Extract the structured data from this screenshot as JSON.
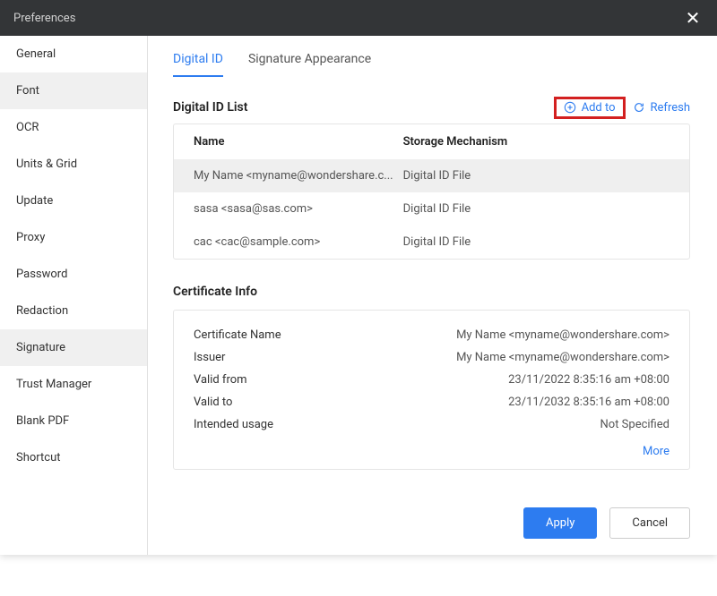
{
  "window": {
    "title": "Preferences"
  },
  "sidebar": {
    "items": [
      {
        "label": "General"
      },
      {
        "label": "Font"
      },
      {
        "label": "OCR"
      },
      {
        "label": "Units & Grid"
      },
      {
        "label": "Update"
      },
      {
        "label": "Proxy"
      },
      {
        "label": "Password"
      },
      {
        "label": "Redaction"
      },
      {
        "label": "Signature"
      },
      {
        "label": "Trust Manager"
      },
      {
        "label": "Blank PDF"
      },
      {
        "label": "Shortcut"
      }
    ],
    "selected_index": 8,
    "hover_index": 1
  },
  "tabs": [
    {
      "label": "Digital ID",
      "active": true
    },
    {
      "label": "Signature Appearance",
      "active": false
    }
  ],
  "list": {
    "title": "Digital ID List",
    "add_label": "Add to",
    "refresh_label": "Refresh",
    "columns": {
      "name": "Name",
      "storage": "Storage Mechanism"
    },
    "rows": [
      {
        "name": "My Name <myname@wondershare.c...",
        "storage": "Digital ID File",
        "selected": true
      },
      {
        "name": "sasa <sasa@sas.com>",
        "storage": "Digital ID File",
        "selected": false
      },
      {
        "name": "cac <cac@sample.com>",
        "storage": "Digital ID File",
        "selected": false
      }
    ]
  },
  "cert": {
    "title": "Certificate Info",
    "rows": [
      {
        "label": "Certificate Name",
        "value": "My Name <myname@wondershare.com>"
      },
      {
        "label": "Issuer",
        "value": "My Name <myname@wondershare.com>"
      },
      {
        "label": "Valid from",
        "value": "23/11/2022 8:35:16 am +08:00"
      },
      {
        "label": "Valid to",
        "value": "23/11/2032 8:35:16 am +08:00"
      },
      {
        "label": "Intended usage",
        "value": "Not Specified"
      }
    ],
    "more_label": "More"
  },
  "footer": {
    "apply": "Apply",
    "cancel": "Cancel"
  }
}
